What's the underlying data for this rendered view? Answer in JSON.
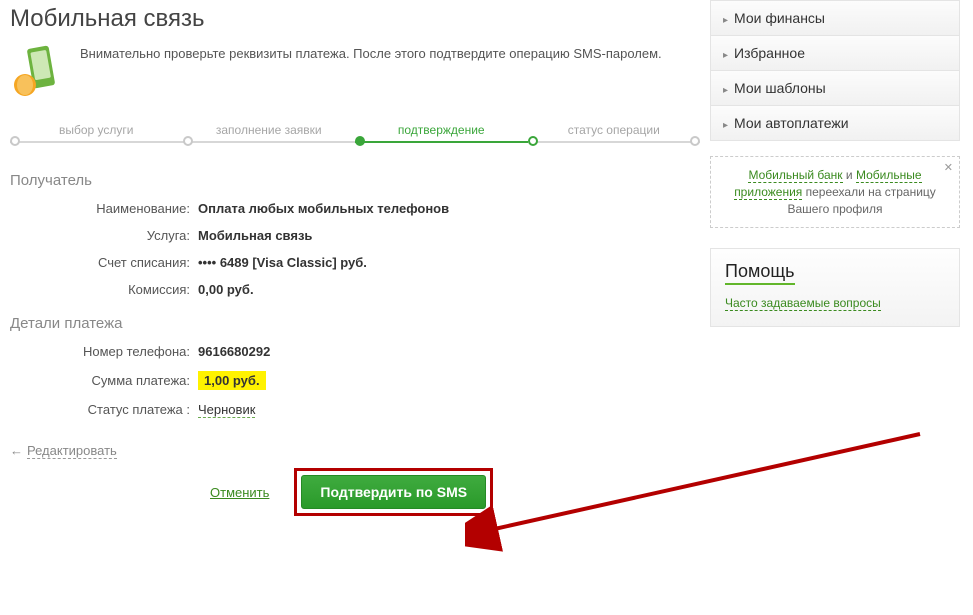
{
  "page": {
    "title": "Мобильная связь",
    "intro": "Внимательно проверьте реквизиты платежа. После этого подтвердите операцию SMS-паролем."
  },
  "progress": {
    "steps": [
      "выбор услуги",
      "заполнение заявки",
      "подтверждение",
      "статус операции"
    ],
    "active_index": 2
  },
  "recipient": {
    "section_title": "Получатель",
    "name_label": "Наименование:",
    "name_value": "Оплата любых мобильных телефонов",
    "service_label": "Услуга:",
    "service_value": "Мобильная связь",
    "account_label": "Счет списания:",
    "account_value": "•••• 6489  [Visa Classic]  руб.",
    "fee_label": "Комиссия:",
    "fee_value": "0,00 руб."
  },
  "details": {
    "section_title": "Детали платежа",
    "phone_label": "Номер телефона:",
    "phone_value": "9616680292",
    "amount_label": "Сумма платежа:",
    "amount_value": "1,00 руб.",
    "status_label": "Статус платежа :",
    "status_value": "Черновик"
  },
  "actions": {
    "edit": "Редактировать",
    "cancel": "Отменить",
    "confirm": "Подтвердить по SMS"
  },
  "sidebar": {
    "items": [
      "Мои финансы",
      "Избранное",
      "Мои шаблоны",
      "Мои автоплатежи"
    ],
    "hint": {
      "link1": "Мобильный банк",
      "mid1": " и ",
      "link2": "Мобильные приложения",
      "tail": " переехали на страницу Вашего профиля"
    },
    "help": {
      "title": "Помощь",
      "faq": "Часто задаваемые вопросы"
    }
  }
}
